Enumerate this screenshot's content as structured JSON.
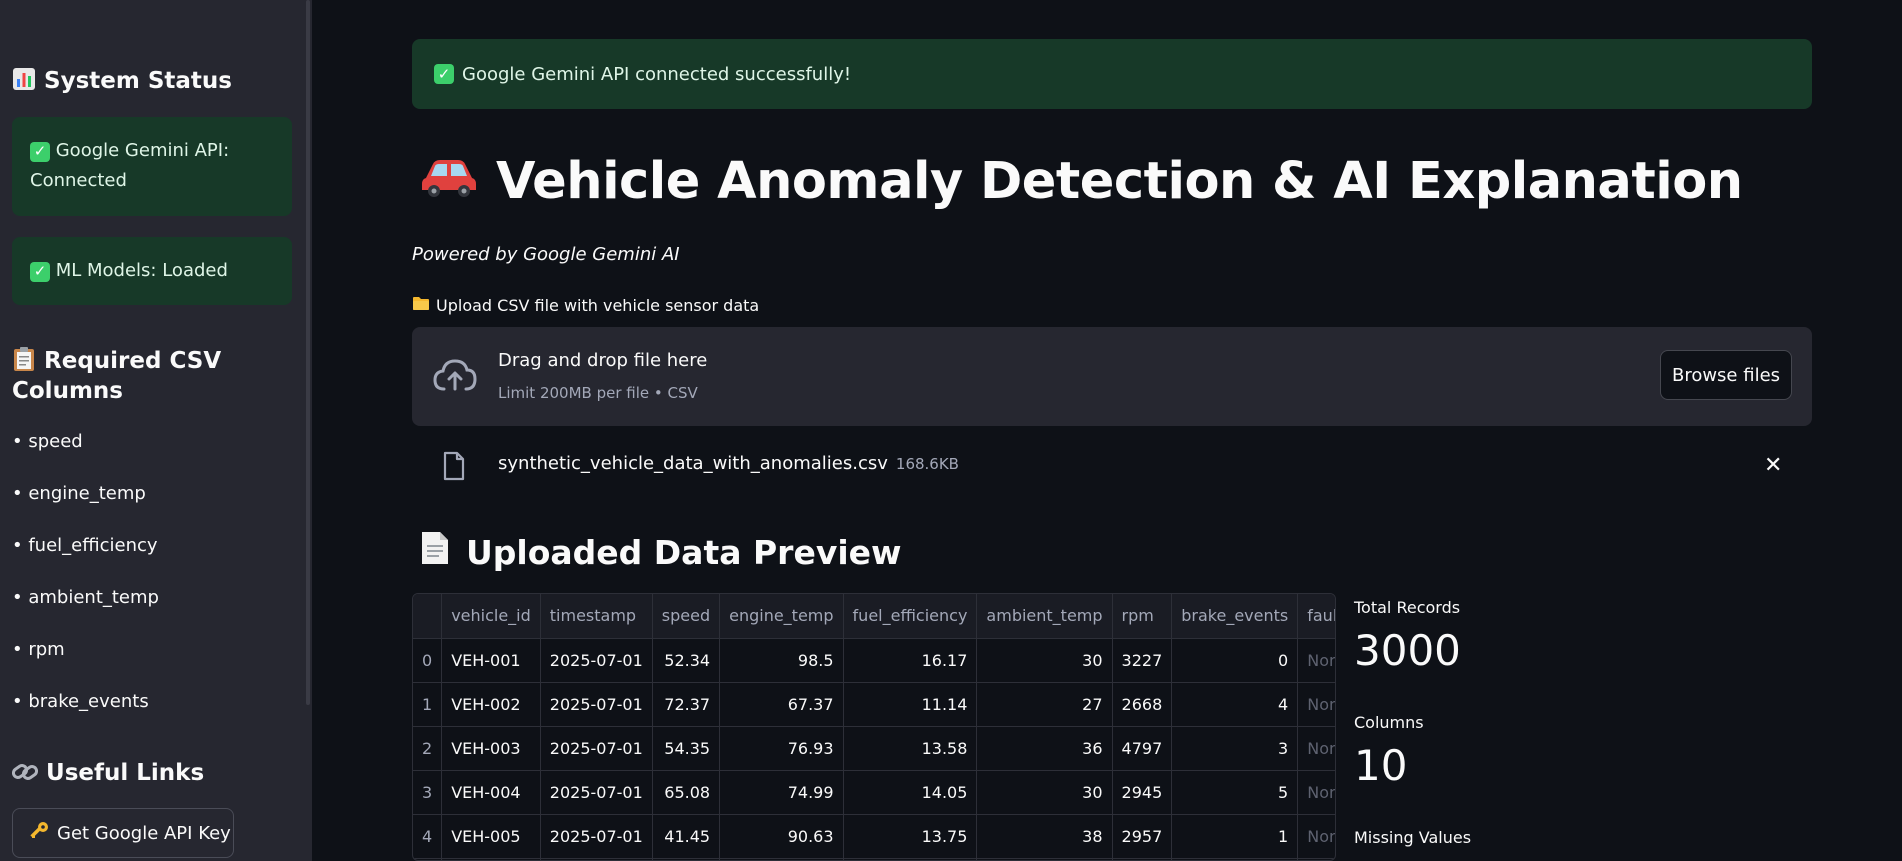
{
  "sidebar": {
    "status_title": "System Status",
    "status_icon": "bar-chart-icon",
    "alerts": [
      {
        "label": "Google Gemini API: Connected"
      },
      {
        "label": "ML Models: Loaded"
      }
    ],
    "columns_title": "Required CSV Columns",
    "columns_icon": "clipboard-icon",
    "columns": [
      "speed",
      "engine_temp",
      "fuel_efficiency",
      "ambient_temp",
      "rpm",
      "brake_events"
    ],
    "links_title": "Useful Links",
    "links_icon": "link-icon",
    "api_key_button": "Get Google API Key"
  },
  "main": {
    "success_message": "Google Gemini API connected successfully!",
    "title": "Vehicle Anomaly Detection & AI Explanation",
    "subtitle": "Powered by Google Gemini AI",
    "upload_label": "Upload CSV file with vehicle sensor data",
    "dropzone": {
      "primary": "Drag and drop file here",
      "secondary": "Limit 200MB per file • CSV",
      "browse_label": "Browse files"
    },
    "file": {
      "name": "synthetic_vehicle_data_with_anomalies.csv",
      "size": "168.6KB"
    },
    "preview_title": "Uploaded Data Preview",
    "table": {
      "headers": [
        "",
        "vehicle_id",
        "timestamp",
        "speed",
        "engine_temp",
        "fuel_efficiency",
        "ambient_temp",
        "rpm",
        "brake_events",
        "fault"
      ],
      "rows": [
        [
          "0",
          "VEH-001",
          "2025-07-01",
          "52.34",
          "98.5",
          "16.17",
          "30",
          "3227",
          "0",
          "None"
        ],
        [
          "1",
          "VEH-002",
          "2025-07-01",
          "72.37",
          "67.37",
          "11.14",
          "27",
          "2668",
          "4",
          "None"
        ],
        [
          "2",
          "VEH-003",
          "2025-07-01",
          "54.35",
          "76.93",
          "13.58",
          "36",
          "4797",
          "3",
          "None"
        ],
        [
          "3",
          "VEH-004",
          "2025-07-01",
          "65.08",
          "74.99",
          "14.05",
          "30",
          "2945",
          "5",
          "None"
        ],
        [
          "4",
          "VEH-005",
          "2025-07-01",
          "41.45",
          "90.63",
          "13.75",
          "38",
          "2957",
          "1",
          "None"
        ]
      ]
    },
    "metrics": [
      {
        "label": "Total Records",
        "value": "3000"
      },
      {
        "label": "Columns",
        "value": "10"
      },
      {
        "label": "Missing Values",
        "value": ""
      }
    ]
  },
  "colors": {
    "background": "#0e1117",
    "sidebar": "#262730",
    "success_bg": "#173928",
    "check": "#3ccf6b"
  }
}
